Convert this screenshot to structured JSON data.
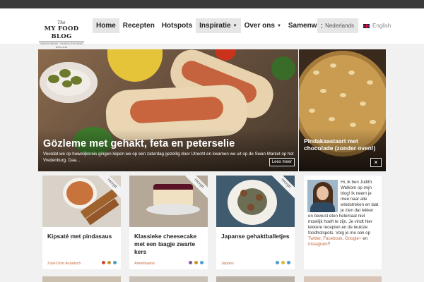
{
  "logo": {
    "line1": "The",
    "line2": "MY FOOD BLOG",
    "line3": "ORIGINAL BRAND · COOKING AND EATING WITH LOVE",
    "line4": "since 2013"
  },
  "nav": {
    "items": [
      {
        "label": "Home",
        "active": true
      },
      {
        "label": "Recepten"
      },
      {
        "label": "Hotspots"
      },
      {
        "label": "Inspiratie",
        "dropdown": true
      },
      {
        "label": "Over ons",
        "dropdown": true
      },
      {
        "label": "Samenwerken?"
      }
    ],
    "search_icon": "search-icon"
  },
  "languages": {
    "current": "Nederlands",
    "other": "English"
  },
  "hero": {
    "title": "Gözleme met gehakt, feta en peterselie",
    "description": "Voordat we op huwelijksreis gingen liepen we op een zaterdag gezellig door Utrecht en kwamen we uit op de Swan Market op het Vredenburg. Daa...",
    "more_label": "Lees meer"
  },
  "side_feature": {
    "title": "Pindakaastaart met chocolade (zonder oven!)",
    "close_label": "✕"
  },
  "cards": [
    {
      "title": "Kipsaté met pindasaus",
      "category": "Zuid-Oost Aziatisch",
      "ribbon": "recept",
      "has_ribbon": true
    },
    {
      "title": "Klassieke cheesecake met een laagje zwarte kers",
      "category": "Amerikaans",
      "ribbon": "recept",
      "has_ribbon": true
    },
    {
      "title": "Japanse gehaktballetjes",
      "category": "Japans",
      "ribbon": "recept",
      "has_ribbon": true
    }
  ],
  "about": {
    "intro": "Hi, ik ben Judith. Welkom op mijn blog! Ik neem je mee naar alle windstreken en laat je zien dat lekker en bewust eten helemaal niet moeilijk hoeft te zijn. Je vindt hier lekkere recepten en de leukste foodhotspots. Volg je me ook op ",
    "links": [
      "Twitter",
      "Facebook",
      "Google+"
    ],
    "and": " en ",
    "last_link": "Instagram",
    "end": "?"
  },
  "colors": {
    "accent": "#c26a3b",
    "topbar": "#3a3a3a"
  }
}
